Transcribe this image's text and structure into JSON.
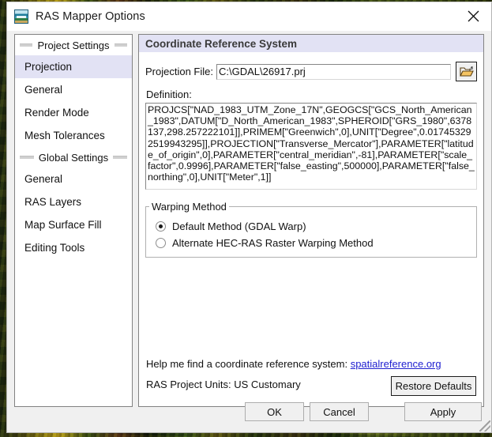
{
  "window": {
    "title": "RAS Mapper Options",
    "icon": "ras-mapper-icon",
    "close_label": "close-icon"
  },
  "sidebar": {
    "groups": [
      {
        "label": "Project Settings",
        "items": [
          {
            "label": "Projection",
            "selected": true
          },
          {
            "label": "General",
            "selected": false
          },
          {
            "label": "Render Mode",
            "selected": false
          },
          {
            "label": "Mesh Tolerances",
            "selected": false
          }
        ]
      },
      {
        "label": "Global Settings",
        "items": [
          {
            "label": "General",
            "selected": false
          },
          {
            "label": "RAS Layers",
            "selected": false
          },
          {
            "label": "Map Surface Fill",
            "selected": false
          },
          {
            "label": "Editing Tools",
            "selected": false
          }
        ]
      }
    ]
  },
  "panel": {
    "header": "Coordinate Reference System",
    "projection_file": {
      "label": "Projection File:",
      "value": "C:\\GDAL\\26917.prj",
      "placeholder": "",
      "browse_icon": "folder-open-icon"
    },
    "definition": {
      "label": "Definition:",
      "value": "PROJCS[\"NAD_1983_UTM_Zone_17N\",GEOGCS[\"GCS_North_American_1983\",DATUM[\"D_North_American_1983\",SPHEROID[\"GRS_1980\",6378137,298.257222101]],PRIMEM[\"Greenwich\",0],UNIT[\"Degree\",0.017453292519943295]],PROJECTION[\"Transverse_Mercator\"],PARAMETER[\"latitude_of_origin\",0],PARAMETER[\"central_meridian\",-81],PARAMETER[\"scale_factor\",0.9996],PARAMETER[\"false_easting\",500000],PARAMETER[\"false_northing\",0],UNIT[\"Meter\",1]]"
    },
    "warping": {
      "legend": "Warping Method",
      "options": [
        {
          "label": "Default Method (GDAL Warp)",
          "checked": true
        },
        {
          "label": "Alternate HEC-RAS Raster Warping Method",
          "checked": false
        }
      ]
    },
    "help": {
      "text": "Help me find a coordinate reference system:",
      "link": "spatialreference.org"
    },
    "units": "RAS Project Units: US Customary",
    "restore_defaults": "Restore Defaults"
  },
  "footer": {
    "ok": "OK",
    "cancel": "Cancel",
    "apply": "Apply"
  },
  "colors": {
    "selection": "#e2e2f4",
    "link": "#2020d0",
    "dialog_bg": "#f0f0f0"
  }
}
